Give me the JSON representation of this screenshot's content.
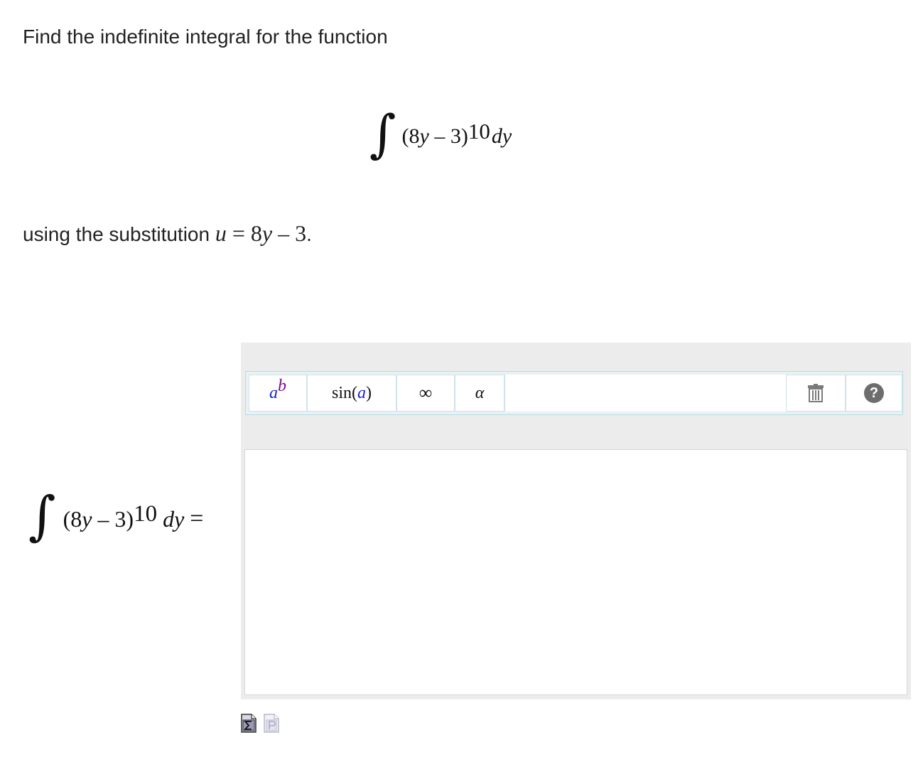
{
  "prompt": {
    "text": "Find the indefinite integral for the function"
  },
  "display_integral": {
    "integrand_open": "(8",
    "var": "y",
    "integrand_close": " – 3)",
    "exponent": "10",
    "differential": "dy"
  },
  "substitution": {
    "prefix": "using the substitution ",
    "u": "u",
    "equals": " = 8",
    "var": "y",
    "rest": " – 3",
    "period": "."
  },
  "answer_integral": {
    "integrand_open": "(8",
    "var": "y",
    "integrand_close": " – 3)",
    "exponent": "10",
    "differential": "dy",
    "equals": "="
  },
  "toolbar": {
    "power_base": "a",
    "power_exp": "b",
    "sin_label": "sin",
    "sin_open": " (",
    "sin_arg": "a",
    "sin_close": ")",
    "infinity": "∞",
    "alpha": "α",
    "help": "?"
  },
  "answer_input": {
    "value": ""
  },
  "icons": {
    "editor_mode": "sigma-doc-icon",
    "preview_mode": "p-doc-icon",
    "trash": "trash-icon",
    "help": "help-icon"
  }
}
